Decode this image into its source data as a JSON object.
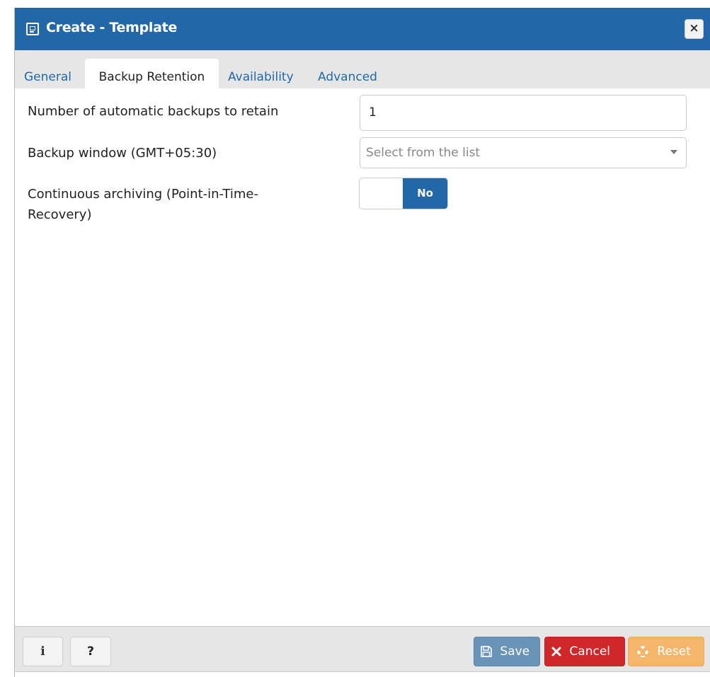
{
  "dialog": {
    "title": "Create - Template",
    "close_label": "×"
  },
  "tabs": [
    {
      "label": "General",
      "active": false
    },
    {
      "label": "Backup Retention",
      "active": true
    },
    {
      "label": "Availability",
      "active": false
    },
    {
      "label": "Advanced",
      "active": false
    }
  ],
  "form": {
    "backups_label": "Number of automatic backups to retain",
    "backups_value": "1",
    "window_label": "Backup window (GMT+05:30)",
    "window_placeholder": "Select from the list",
    "archiving_label_line1": "Continuous archiving (Point-in-Time-",
    "archiving_label_line2": "Recovery)",
    "archiving_toggle": "No"
  },
  "footer": {
    "info_label": "i",
    "help_label": "?",
    "save_label": "Save",
    "cancel_label": "Cancel",
    "reset_label": "Reset"
  },
  "colors": {
    "primary": "#2268a9",
    "save": "#6a93b8",
    "cancel": "#d0272a",
    "reset": "#f5b56a"
  }
}
